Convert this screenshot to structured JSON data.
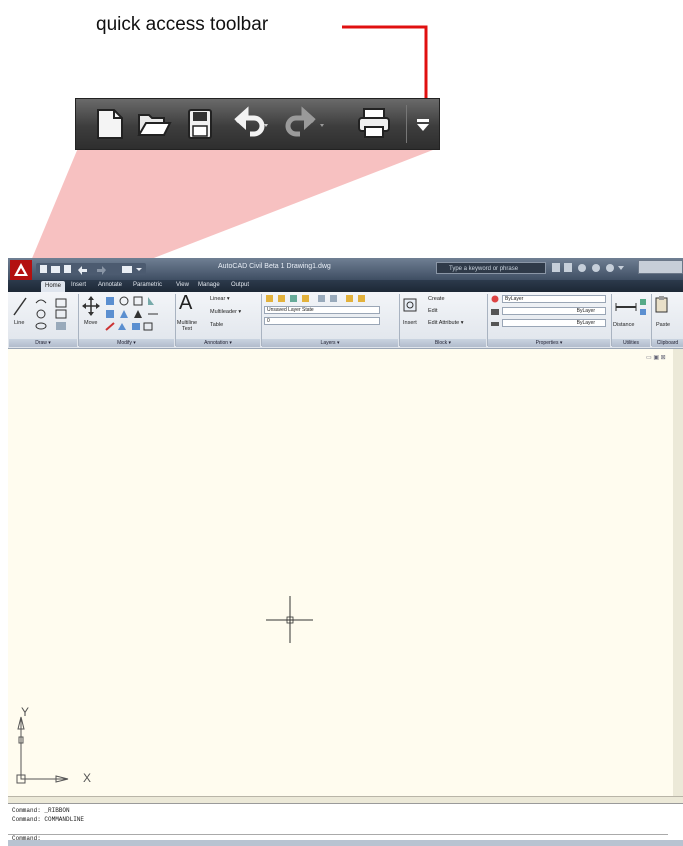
{
  "callout": {
    "label": "quick access toolbar",
    "line_color": "#e01010"
  },
  "zoom_toolbar": {
    "icons": [
      "new-icon",
      "open-icon",
      "save-icon",
      "undo-icon",
      "redo-icon",
      "plot-icon",
      "customize-dropdown-icon"
    ]
  },
  "window": {
    "title": "AutoCAD Civil Beta 1   Drawing1.dwg",
    "search_placeholder": "Type a keyword or phrase",
    "tabs": [
      "Home",
      "Insert",
      "Annotate",
      "Parametric",
      "View",
      "Manage",
      "Output"
    ]
  },
  "ribbon": {
    "draw": {
      "line_label": "Line",
      "panel_title": "Draw ▾"
    },
    "modify": {
      "move_label": "Move",
      "panel_title": "Modify ▾"
    },
    "annotation": {
      "mtext_label": "Multiline Text",
      "linear": "Linear ▾",
      "multileader": "Multileader ▾",
      "table": "Table",
      "panel_title": "Annotation ▾"
    },
    "layers": {
      "state": "Unsaved Layer State",
      "current": "0",
      "panel_title": "Layers ▾"
    },
    "block": {
      "insert_label": "Insert",
      "create": "Create",
      "edit": "Edit",
      "edit_attribute": "Edit Attribute ▾",
      "panel_title": "Block ▾"
    },
    "properties": {
      "color": "ByLayer",
      "linetype": "ByLayer",
      "lineweight": "ByLayer",
      "panel_title": "Properties ▾"
    },
    "utilities": {
      "distance_label": "Distance",
      "panel_title": "Utilities"
    },
    "clipboard": {
      "paste_label": "Paste",
      "panel_title": "Clipboard"
    }
  },
  "ucs": {
    "y_label": "Y",
    "x_label": "X"
  },
  "command": {
    "history": [
      "Command:  _RIBBON",
      "Command:  COMMANDLINE"
    ],
    "prompt": "Command:"
  },
  "colors": {
    "drawing_bg": "#fffcef",
    "highlight_fan": "#f6b6b6",
    "toolbar_dark": "#3d3d3d"
  }
}
